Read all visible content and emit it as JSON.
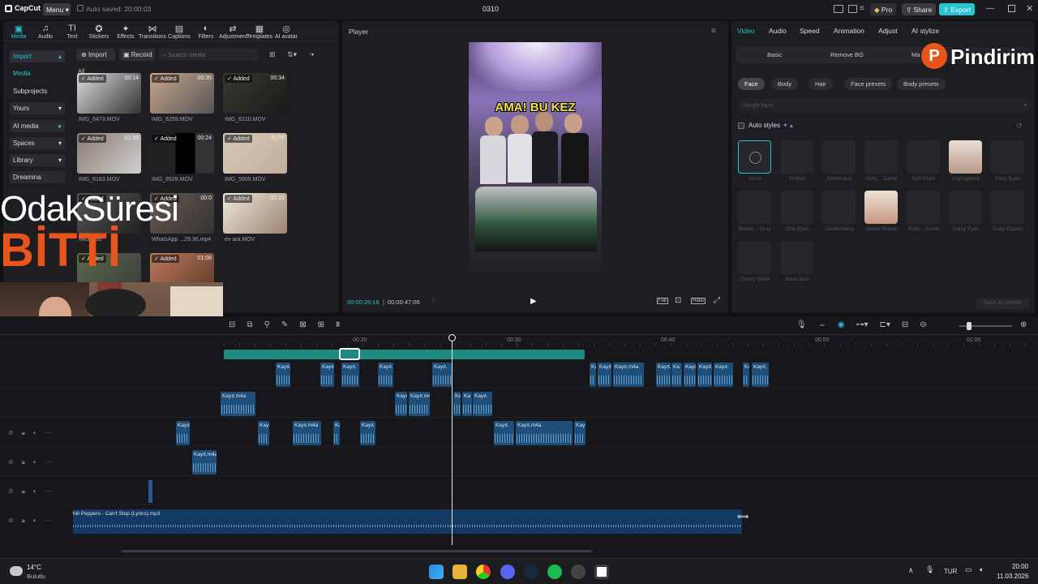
{
  "app": {
    "name": "CapCut",
    "menu_label": "Menu",
    "autosave": "Auto saved: 20:00:03",
    "project_title": "0310",
    "pro_label": "Pro",
    "share_label": "Share",
    "export_label": "Export"
  },
  "toolbar": {
    "tools": [
      {
        "label": "Media",
        "icon": "media-icon"
      },
      {
        "label": "Audio",
        "icon": "audio-icon"
      },
      {
        "label": "Text",
        "icon": "text-icon"
      },
      {
        "label": "Stickers",
        "icon": "stickers-icon"
      },
      {
        "label": "Effects",
        "icon": "effects-icon"
      },
      {
        "label": "Transitions",
        "icon": "transitions-icon"
      },
      {
        "label": "Captions",
        "icon": "captions-icon"
      },
      {
        "label": "Filters",
        "icon": "filters-icon"
      },
      {
        "label": "Adjustment",
        "icon": "adjustment-icon"
      },
      {
        "label": "Templates",
        "icon": "templates-icon"
      },
      {
        "label": "AI avatar",
        "icon": "ai-avatar-icon"
      }
    ]
  },
  "media": {
    "sidebar": [
      "Import",
      "Media",
      "Subprojects",
      "Yours",
      "AI media",
      "Spaces",
      "Library",
      "Dreamina"
    ],
    "import_label": "Import",
    "record_label": "Record",
    "search_placeholder": "Search media",
    "filter_all": "All",
    "added_label": "Added",
    "items": [
      {
        "name": "IMG_6473.MOV",
        "duration": "00:14"
      },
      {
        "name": "IMG_6259.MOV",
        "duration": "00:35"
      },
      {
        "name": "IMG_6210.MOV",
        "duration": "00:34"
      },
      {
        "name": "IMG_6183.MOV",
        "duration": "01:39"
      },
      {
        "name": "IMG_6528.MOV",
        "duration": "00:24"
      },
      {
        "name": "IMG_5905.MOV",
        "duration": "00:06"
      },
      {
        "name": "IMG_590",
        "duration": ""
      },
      {
        "name": "WhatsApp ...29.36.mp4",
        "duration": "00:0"
      },
      {
        "name": "ev ara.MOV",
        "duration": "01:20"
      },
      {
        "name": "",
        "duration": ""
      },
      {
        "name": "",
        "duration": "01:08"
      }
    ]
  },
  "overlay": {
    "line1": "OdakSüresi",
    "line2": "BİTTİ",
    "watermark": "Pindirim"
  },
  "player": {
    "title": "Player",
    "caption": "AMA! BU KEZ",
    "current_time": "00:00:26:16",
    "total_time": "00:00:47:06",
    "full_label": "Full",
    "ratio_label": "Ratio"
  },
  "inspector": {
    "tabs": [
      "Video",
      "Audio",
      "Speed",
      "Animation",
      "Adjust",
      "AI stylize"
    ],
    "subtabs": [
      "Basic",
      "Remove BG",
      "Ma"
    ],
    "chips": [
      "Face",
      "Body",
      "Hair",
      "Face presets",
      "Body presets"
    ],
    "face_select": "Single face",
    "auto_styles": "Auto styles",
    "presets": [
      "None",
      "Trollme",
      "Americano",
      "Holly... Game",
      "Soft Glam",
      "Highlighted",
      "Fairy Eyes",
      "Bambi... Gray",
      "Chic Eyes",
      "Gentlemanly",
      "Sweet Bloom",
      "Rolly... model",
      "Daisy Eyes",
      "Dolly Classic",
      "Cherry Smile",
      "Soda blue"
    ],
    "save_preset": "Save as preset"
  },
  "timeline": {
    "ruler": [
      "00:20",
      "00:30",
      "00:40",
      "00:50",
      "01:00"
    ],
    "audio_track_label": "hili Peppers - Can't Stop (Lyrics).mp3",
    "clip_label": "Kayıt.m4a",
    "clip_short": "Kayıt.",
    "clip_tiny": "Ka"
  },
  "taskbar": {
    "temp": "14°C",
    "weather": "Bulutlu",
    "lang": "TUR",
    "time": "20:00",
    "date": "11.03.2026"
  },
  "colors": {
    "accent": "#27c4d4",
    "clip": "#1d4f7a",
    "overlay_orange": "#e8541c"
  }
}
